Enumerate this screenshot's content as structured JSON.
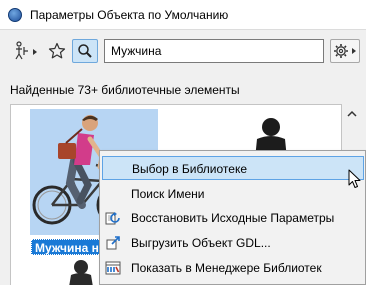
{
  "window": {
    "title": "Параметры Объекта по Умолчанию",
    "app_icon": "archicad-icon"
  },
  "toolbar": {
    "object_type_icon": "object-type-figure-icon",
    "favorites_icon": "star-icon",
    "search_icon": "magnifier-icon",
    "search_value": "Мужчина",
    "settings_icon": "gear-icon"
  },
  "results": {
    "count_text": "Найденные 73+ библиотечные элементы",
    "selected_item_label": "Мужчина на Велосипеде",
    "colors": {
      "selection": "#1979d6",
      "thumb_bg": "#b7d5f3"
    }
  },
  "context_menu": {
    "items": [
      {
        "label": "Выбор в Библиотеке",
        "icon": "",
        "highlighted": true
      },
      {
        "label": "Поиск Имени",
        "icon": ""
      },
      {
        "label": "Восстановить Исходные Параметры",
        "icon": "restore-defaults-icon"
      },
      {
        "label": "Выгрузить Объект GDL...",
        "icon": "export-gdl-icon"
      },
      {
        "label": "Показать в Менеджере Библиотек",
        "icon": "library-manager-icon"
      }
    ],
    "highlight_color": "#cce4f7"
  }
}
